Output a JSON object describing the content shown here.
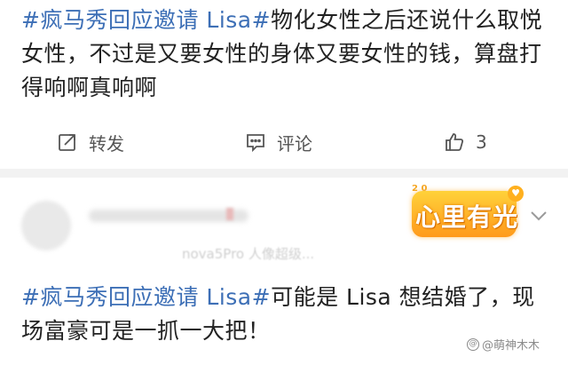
{
  "post1": {
    "hashtag": "#疯马秀回应邀请 Lisa#",
    "text": "物化女性之后还说什么取悦女性，不过是又要女性的身体又要女性的钱，算盘打得响啊真响啊"
  },
  "actions": {
    "repost_label": "转发",
    "comment_label": "评论",
    "like_count": "3"
  },
  "post2": {
    "badge_text": "心里有光",
    "badge_dots": "2 0",
    "device_text": "nova5Pro 人像超级...",
    "hashtag": "#疯马秀回应邀请 Lisa#",
    "text": "可能是 Lisa 想结婚了，现场富豪可是一抓一大把！"
  },
  "watermark": {
    "text": "@萌神木木"
  },
  "colors": {
    "hashtag": "#3d6fb6",
    "divider": "#f2f2f2",
    "badge": "#ffb01f"
  },
  "icons": {
    "repost": "repost-icon",
    "comment": "comment-icon",
    "like": "thumbs-up-icon",
    "more": "chevron-down-icon"
  }
}
